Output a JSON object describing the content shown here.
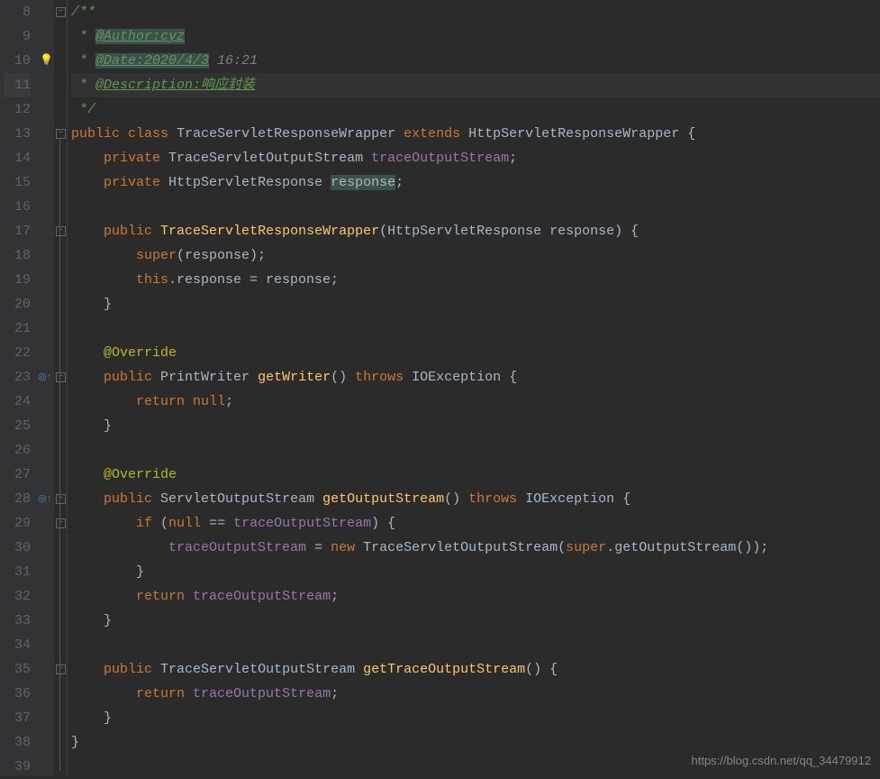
{
  "watermark": "https://blog.csdn.net/qq_34479912",
  "lines": [
    {
      "n": 8,
      "tokens": [
        [
          "doc",
          "/**"
        ]
      ],
      "fold": "minus"
    },
    {
      "n": 9,
      "tokens": [
        [
          "doc",
          " * "
        ],
        [
          "doctag",
          "@Author:cyz"
        ]
      ]
    },
    {
      "n": 10,
      "tokens": [
        [
          "doc",
          " * "
        ],
        [
          "doctag",
          "@Date:2020/4/3"
        ],
        [
          "docdate",
          " 16:21"
        ]
      ],
      "bulb": true
    },
    {
      "n": 11,
      "tokens": [
        [
          "doc",
          " * "
        ],
        [
          "doctag2",
          "@Description:响应封装"
        ]
      ],
      "current": true
    },
    {
      "n": 12,
      "tokens": [
        [
          "doc",
          " */"
        ]
      ]
    },
    {
      "n": 13,
      "tokens": [
        [
          "kw",
          "public"
        ],
        [
          "",
          " "
        ],
        [
          "kw",
          "class"
        ],
        [
          "",
          " "
        ],
        [
          "cls",
          "TraceServletResponseWrapper"
        ],
        [
          "",
          " "
        ],
        [
          "kw",
          "extends"
        ],
        [
          "",
          " "
        ],
        [
          "cls",
          "HttpServletResponseWrapper"
        ],
        [
          "",
          " {"
        ]
      ],
      "fold": "minus"
    },
    {
      "n": 14,
      "tokens": [
        [
          "",
          "    "
        ],
        [
          "kw",
          "private"
        ],
        [
          "",
          " "
        ],
        [
          "cls",
          "TraceServletOutputStream"
        ],
        [
          "",
          " "
        ],
        [
          "fld",
          "traceOutputStream"
        ],
        [
          "",
          ";"
        ]
      ]
    },
    {
      "n": 15,
      "tokens": [
        [
          "",
          "    "
        ],
        [
          "kw",
          "private"
        ],
        [
          "",
          " "
        ],
        [
          "cls",
          "HttpServletResponse"
        ],
        [
          "",
          " "
        ],
        [
          "hl",
          "response"
        ],
        [
          "",
          ";"
        ]
      ]
    },
    {
      "n": 16,
      "tokens": []
    },
    {
      "n": 17,
      "tokens": [
        [
          "",
          "    "
        ],
        [
          "kw",
          "public"
        ],
        [
          "",
          " "
        ],
        [
          "mtd",
          "TraceServletResponseWrapper"
        ],
        [
          "",
          "("
        ],
        [
          "cls",
          "HttpServletResponse"
        ],
        [
          "",
          " response) {"
        ]
      ],
      "fold": "minus"
    },
    {
      "n": 18,
      "tokens": [
        [
          "",
          "        "
        ],
        [
          "kw",
          "super"
        ],
        [
          "",
          "(response);"
        ]
      ]
    },
    {
      "n": 19,
      "tokens": [
        [
          "",
          "        "
        ],
        [
          "kw",
          "this"
        ],
        [
          "",
          ".response = response;"
        ]
      ]
    },
    {
      "n": 20,
      "tokens": [
        [
          "",
          "    }"
        ]
      ],
      "fold": "end"
    },
    {
      "n": 21,
      "tokens": []
    },
    {
      "n": 22,
      "tokens": [
        [
          "",
          "    "
        ],
        [
          "ann",
          "@Override"
        ]
      ]
    },
    {
      "n": 23,
      "tokens": [
        [
          "",
          "    "
        ],
        [
          "kw",
          "public"
        ],
        [
          "",
          " "
        ],
        [
          "cls",
          "PrintWriter"
        ],
        [
          "",
          " "
        ],
        [
          "mtd",
          "getWriter"
        ],
        [
          "",
          "() "
        ],
        [
          "kw",
          "throws"
        ],
        [
          "",
          " "
        ],
        [
          "cls",
          "IOException"
        ],
        [
          "",
          " {"
        ]
      ],
      "fold": "minus",
      "override": true
    },
    {
      "n": 24,
      "tokens": [
        [
          "",
          "        "
        ],
        [
          "kw",
          "return"
        ],
        [
          "",
          " "
        ],
        [
          "kw",
          "null"
        ],
        [
          "",
          ";"
        ]
      ]
    },
    {
      "n": 25,
      "tokens": [
        [
          "",
          "    }"
        ]
      ],
      "fold": "end"
    },
    {
      "n": 26,
      "tokens": []
    },
    {
      "n": 27,
      "tokens": [
        [
          "",
          "    "
        ],
        [
          "ann",
          "@Override"
        ]
      ]
    },
    {
      "n": 28,
      "tokens": [
        [
          "",
          "    "
        ],
        [
          "kw",
          "public"
        ],
        [
          "",
          " "
        ],
        [
          "cls",
          "ServletOutputStream"
        ],
        [
          "",
          " "
        ],
        [
          "mtd",
          "getOutputStream"
        ],
        [
          "",
          "() "
        ],
        [
          "kw",
          "throws"
        ],
        [
          "",
          " "
        ],
        [
          "cls",
          "IOException"
        ],
        [
          "",
          " {"
        ]
      ],
      "fold": "minus",
      "override": true
    },
    {
      "n": 29,
      "tokens": [
        [
          "",
          "        "
        ],
        [
          "kw",
          "if"
        ],
        [
          "",
          " ("
        ],
        [
          "kw",
          "null"
        ],
        [
          "",
          " == "
        ],
        [
          "fld",
          "traceOutputStream"
        ],
        [
          "",
          ") {"
        ]
      ],
      "fold": "minus"
    },
    {
      "n": 30,
      "tokens": [
        [
          "",
          "            "
        ],
        [
          "fld",
          "traceOutputStream"
        ],
        [
          "",
          " = "
        ],
        [
          "kw",
          "new"
        ],
        [
          "",
          " "
        ],
        [
          "cls",
          "TraceServletOutputStream"
        ],
        [
          "",
          "("
        ],
        [
          "kw",
          "super"
        ],
        [
          "",
          ".getOutputStream());"
        ]
      ]
    },
    {
      "n": 31,
      "tokens": [
        [
          "",
          "        }"
        ]
      ],
      "fold": "end"
    },
    {
      "n": 32,
      "tokens": [
        [
          "",
          "        "
        ],
        [
          "kw",
          "return"
        ],
        [
          "",
          " "
        ],
        [
          "fld",
          "traceOutputStream"
        ],
        [
          "",
          ";"
        ]
      ]
    },
    {
      "n": 33,
      "tokens": [
        [
          "",
          "    }"
        ]
      ],
      "fold": "end"
    },
    {
      "n": 34,
      "tokens": []
    },
    {
      "n": 35,
      "tokens": [
        [
          "",
          "    "
        ],
        [
          "kw",
          "public"
        ],
        [
          "",
          " "
        ],
        [
          "cls",
          "TraceServletOutputStream"
        ],
        [
          "",
          " "
        ],
        [
          "mtd",
          "getTraceOutputStream"
        ],
        [
          "",
          "() {"
        ]
      ],
      "fold": "minus"
    },
    {
      "n": 36,
      "tokens": [
        [
          "",
          "        "
        ],
        [
          "kw",
          "return"
        ],
        [
          "",
          " "
        ],
        [
          "fld",
          "traceOutputStream"
        ],
        [
          "",
          ";"
        ]
      ]
    },
    {
      "n": 37,
      "tokens": [
        [
          "",
          "    }"
        ]
      ],
      "fold": "end"
    },
    {
      "n": 38,
      "tokens": [
        [
          "",
          "}"
        ]
      ],
      "fold": "end"
    },
    {
      "n": 39,
      "tokens": []
    }
  ]
}
